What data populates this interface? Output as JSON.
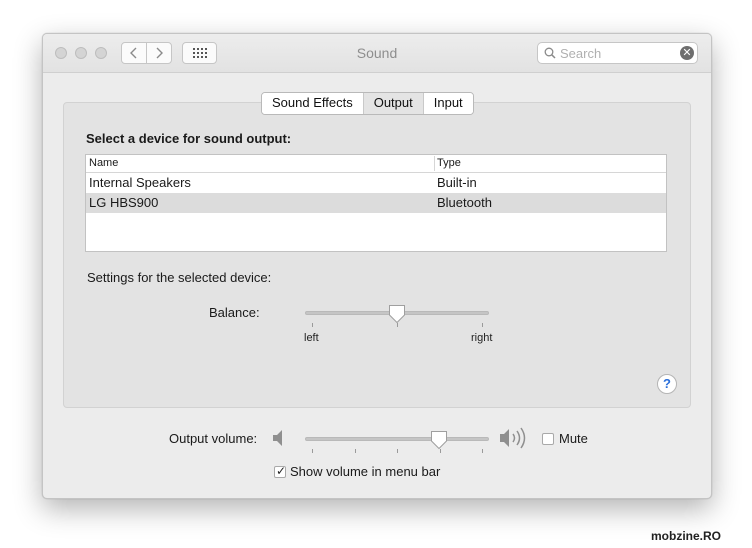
{
  "window": {
    "title": "Sound"
  },
  "search": {
    "placeholder": "Search"
  },
  "tabs": [
    {
      "label": "Sound Effects",
      "selected": false
    },
    {
      "label": "Output",
      "selected": true
    },
    {
      "label": "Input",
      "selected": false
    }
  ],
  "output": {
    "heading": "Select a device for sound output:",
    "columns": [
      "Name",
      "Type"
    ],
    "devices": [
      {
        "name": "Internal Speakers",
        "type": "Built-in",
        "selected": false
      },
      {
        "name": "LG HBS900",
        "type": "Bluetooth",
        "selected": true
      }
    ],
    "settings_label": "Settings for the selected device:",
    "balance": {
      "label": "Balance:",
      "left_label": "left",
      "right_label": "right",
      "value": 0.5
    }
  },
  "help": {
    "glyph": "?"
  },
  "volume": {
    "label": "Output volume:",
    "value": 0.73,
    "mute_label": "Mute",
    "mute_checked": false,
    "show_in_menubar_label": "Show volume in menu bar",
    "show_in_menubar_checked": true
  },
  "watermark": "mobzine.RO",
  "icons": [
    "traffic-light",
    "back-arrow",
    "forward-arrow",
    "grid",
    "search",
    "clear",
    "speaker-low",
    "speaker-high",
    "help",
    "checkmark"
  ],
  "colors": {
    "window_bg": "#ececec",
    "panel_bg": "#e3e3e3",
    "selected_row": "#dcdcdc",
    "help_accent": "#2a6fdb"
  }
}
